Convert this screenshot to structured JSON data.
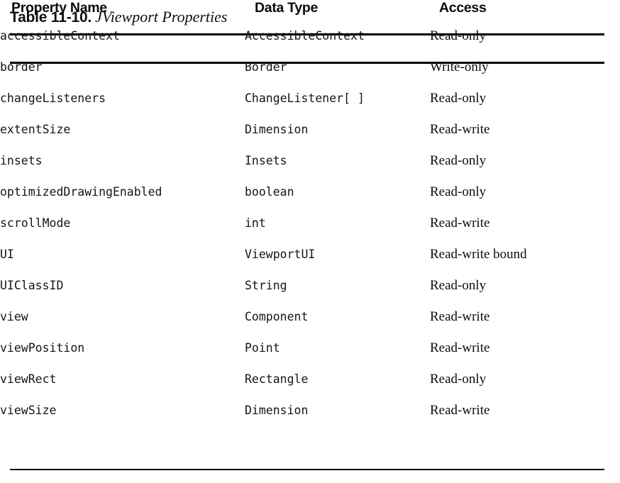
{
  "caption": {
    "label": "Table 11-10.",
    "title": "JViewport Properties"
  },
  "table": {
    "columns": [
      "Property Name",
      "Data Type",
      "Access"
    ],
    "rows": [
      {
        "property": "accessibleContext",
        "type": "AccessibleContext",
        "access": "Read-only"
      },
      {
        "property": "border",
        "type": "Border",
        "access": "Write-only"
      },
      {
        "property": "changeListeners",
        "type": "ChangeListener[ ]",
        "access": "Read-only"
      },
      {
        "property": "extentSize",
        "type": "Dimension",
        "access": "Read-write"
      },
      {
        "property": "insets",
        "type": "Insets",
        "access": "Read-only"
      },
      {
        "property": "optimizedDrawingEnabled",
        "type": "boolean",
        "access": "Read-only"
      },
      {
        "property": "scrollMode",
        "type": "int",
        "access": "Read-write"
      },
      {
        "property": "UI",
        "type": "ViewportUI",
        "access": "Read-write bound"
      },
      {
        "property": "UIClassID",
        "type": "String",
        "access": "Read-only"
      },
      {
        "property": "view",
        "type": "Component",
        "access": "Read-write"
      },
      {
        "property": "viewPosition",
        "type": "Point",
        "access": "Read-write"
      },
      {
        "property": "viewRect",
        "type": "Rectangle",
        "access": "Read-only"
      },
      {
        "property": "viewSize",
        "type": "Dimension",
        "access": "Read-write"
      }
    ]
  },
  "colors": {
    "background": "#ffffff",
    "text": "#111111",
    "rule": "#000000"
  }
}
